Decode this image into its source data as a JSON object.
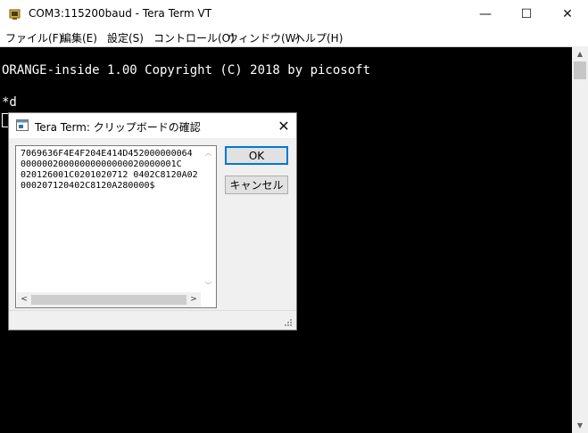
{
  "window": {
    "title": "COM3:115200baud - Tera Term VT",
    "minimize": "—",
    "maximize": "☐",
    "close": "✕"
  },
  "menu": {
    "items": [
      "ファイル(F)",
      "編集(E)",
      "設定(S)",
      "コントロール(O)",
      "ウィンドウ(W)",
      "ヘルプ(H)"
    ]
  },
  "terminal": {
    "lines": [
      "ORANGE-inside 1.00 Copyright (C) 2018 by picosoft",
      "*d"
    ],
    "background": "#000000",
    "foreground": "#ffffff"
  },
  "scrollbar": {
    "up": "▲",
    "down": "▼"
  },
  "dialog": {
    "title": "Tera Term: クリップボードの確認",
    "close": "✕",
    "content_lines": [
      "7069636F4E4F204E414D452000000064",
      "00000020000000000000020000001C",
      "020126001C0201020712 0402C8120A02",
      "000207120402C8120A280000$"
    ],
    "ok_label": "OK",
    "cancel_label": "キャンセル",
    "scroll_up": "︿",
    "scroll_down": "﹀",
    "scroll_left": "<",
    "scroll_right": ">"
  },
  "colors": {
    "accent": "#0078d7",
    "dialog_bg": "#f0f0f0"
  }
}
